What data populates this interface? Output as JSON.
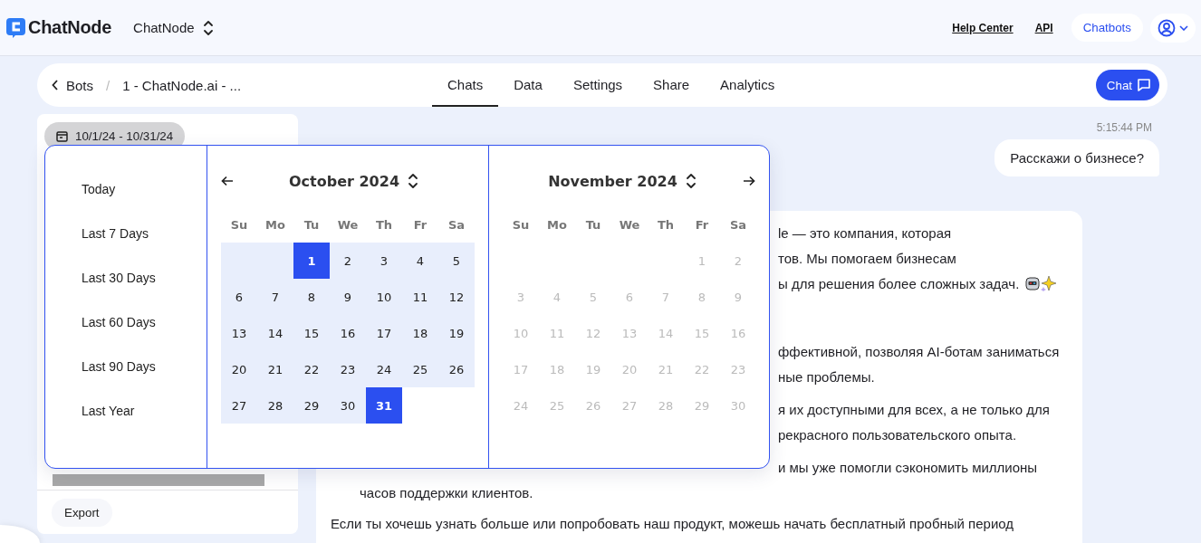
{
  "header": {
    "logo": "ChatNode",
    "workspace": "ChatNode",
    "links": [
      "Help Center",
      "API"
    ],
    "chatbots_button": "Chatbots"
  },
  "nav": {
    "back": "Bots",
    "separator": "/",
    "breadcrumb": "1 - ChatNode.ai - ...",
    "chat_button": "Chat",
    "tabs": [
      {
        "label": "Chats",
        "selected": true
      },
      {
        "label": "Data",
        "selected": false
      },
      {
        "label": "Settings",
        "selected": false
      },
      {
        "label": "Share",
        "selected": false
      },
      {
        "label": "Analytics",
        "selected": false
      }
    ]
  },
  "sidebar": {
    "date_range": "10/1/24 - 10/31/24",
    "export": "Export"
  },
  "date_picker": {
    "presets": [
      "Today",
      "Last 7 Days",
      "Last 30 Days",
      "Last 60 Days",
      "Last 90 Days",
      "Last Year"
    ],
    "months": [
      {
        "title": "October 2024",
        "weekdays": [
          "Su",
          "Mo",
          "Tu",
          "We",
          "Th",
          "Fr",
          "Sa"
        ],
        "weeks": [
          [
            {
              "kind": "blank",
              "in_range": true
            },
            {
              "kind": "blank",
              "in_range": true
            },
            {
              "label": "1",
              "selected": true,
              "in_range": true,
              "disabled": false
            },
            {
              "label": "2",
              "selected": false,
              "in_range": true,
              "disabled": false
            },
            {
              "label": "3",
              "selected": false,
              "in_range": true,
              "disabled": false
            },
            {
              "label": "4",
              "selected": false,
              "in_range": true,
              "disabled": false
            },
            {
              "label": "5",
              "selected": false,
              "in_range": true,
              "disabled": false
            }
          ],
          [
            {
              "label": "6",
              "selected": false,
              "in_range": true,
              "disabled": false
            },
            {
              "label": "7",
              "selected": false,
              "in_range": true,
              "disabled": false
            },
            {
              "label": "8",
              "selected": false,
              "in_range": true,
              "disabled": false
            },
            {
              "label": "9",
              "selected": false,
              "in_range": true,
              "disabled": false
            },
            {
              "label": "10",
              "selected": false,
              "in_range": true,
              "disabled": false
            },
            {
              "label": "11",
              "selected": false,
              "in_range": true,
              "disabled": false
            },
            {
              "label": "12",
              "selected": false,
              "in_range": true,
              "disabled": false
            }
          ],
          [
            {
              "label": "13",
              "selected": false,
              "in_range": true,
              "disabled": false
            },
            {
              "label": "14",
              "selected": false,
              "in_range": true,
              "disabled": false
            },
            {
              "label": "15",
              "selected": false,
              "in_range": true,
              "disabled": false
            },
            {
              "label": "16",
              "selected": false,
              "in_range": true,
              "disabled": false
            },
            {
              "label": "17",
              "selected": false,
              "in_range": true,
              "disabled": false
            },
            {
              "label": "18",
              "selected": false,
              "in_range": true,
              "disabled": false
            },
            {
              "label": "19",
              "selected": false,
              "in_range": true,
              "disabled": false
            }
          ],
          [
            {
              "label": "20",
              "selected": false,
              "in_range": true,
              "disabled": false
            },
            {
              "label": "21",
              "selected": false,
              "in_range": true,
              "disabled": false
            },
            {
              "label": "22",
              "selected": false,
              "in_range": true,
              "disabled": false
            },
            {
              "label": "23",
              "selected": false,
              "in_range": true,
              "disabled": false
            },
            {
              "label": "24",
              "selected": false,
              "in_range": true,
              "disabled": false
            },
            {
              "label": "25",
              "selected": false,
              "in_range": true,
              "disabled": false
            },
            {
              "label": "26",
              "selected": false,
              "in_range": true,
              "disabled": false
            }
          ],
          [
            {
              "label": "27",
              "selected": false,
              "in_range": true,
              "disabled": false
            },
            {
              "label": "28",
              "selected": false,
              "in_range": true,
              "disabled": false
            },
            {
              "label": "29",
              "selected": false,
              "in_range": true,
              "disabled": false
            },
            {
              "label": "30",
              "selected": false,
              "in_range": true,
              "disabled": false
            },
            {
              "label": "31",
              "selected": true,
              "in_range": true,
              "disabled": false
            }
          ]
        ]
      },
      {
        "title": "November 2024",
        "weekdays": [
          "Su",
          "Mo",
          "Tu",
          "We",
          "Th",
          "Fr",
          "Sa"
        ],
        "weeks": [
          [
            {
              "kind": "blank"
            },
            {
              "kind": "blank"
            },
            {
              "kind": "blank"
            },
            {
              "kind": "blank"
            },
            {
              "kind": "blank"
            },
            {
              "label": "1",
              "selected": false,
              "in_range": false,
              "disabled": true
            },
            {
              "label": "2",
              "selected": false,
              "in_range": false,
              "disabled": true
            }
          ],
          [
            {
              "label": "3",
              "selected": false,
              "in_range": false,
              "disabled": true
            },
            {
              "label": "4",
              "selected": false,
              "in_range": false,
              "disabled": true
            },
            {
              "label": "5",
              "selected": false,
              "in_range": false,
              "disabled": true
            },
            {
              "label": "6",
              "selected": false,
              "in_range": false,
              "disabled": true
            },
            {
              "label": "7",
              "selected": false,
              "in_range": false,
              "disabled": true
            },
            {
              "label": "8",
              "selected": false,
              "in_range": false,
              "disabled": true
            },
            {
              "label": "9",
              "selected": false,
              "in_range": false,
              "disabled": true
            }
          ],
          [
            {
              "label": "10",
              "selected": false,
              "in_range": false,
              "disabled": true
            },
            {
              "label": "11",
              "selected": false,
              "in_range": false,
              "disabled": true
            },
            {
              "label": "12",
              "selected": false,
              "in_range": false,
              "disabled": true
            },
            {
              "label": "13",
              "selected": false,
              "in_range": false,
              "disabled": true
            },
            {
              "label": "14",
              "selected": false,
              "in_range": false,
              "disabled": true
            },
            {
              "label": "15",
              "selected": false,
              "in_range": false,
              "disabled": true
            },
            {
              "label": "16",
              "selected": false,
              "in_range": false,
              "disabled": true
            }
          ],
          [
            {
              "label": "17",
              "selected": false,
              "in_range": false,
              "disabled": true
            },
            {
              "label": "18",
              "selected": false,
              "in_range": false,
              "disabled": true
            },
            {
              "label": "19",
              "selected": false,
              "in_range": false,
              "disabled": true
            },
            {
              "label": "20",
              "selected": false,
              "in_range": false,
              "disabled": true
            },
            {
              "label": "21",
              "selected": false,
              "in_range": false,
              "disabled": true
            },
            {
              "label": "22",
              "selected": false,
              "in_range": false,
              "disabled": true
            },
            {
              "label": "23",
              "selected": false,
              "in_range": false,
              "disabled": true
            }
          ],
          [
            {
              "label": "24",
              "selected": false,
              "in_range": false,
              "disabled": true
            },
            {
              "label": "25",
              "selected": false,
              "in_range": false,
              "disabled": true
            },
            {
              "label": "26",
              "selected": false,
              "in_range": false,
              "disabled": true
            },
            {
              "label": "27",
              "selected": false,
              "in_range": false,
              "disabled": true
            },
            {
              "label": "28",
              "selected": false,
              "in_range": false,
              "disabled": true
            },
            {
              "label": "29",
              "selected": false,
              "in_range": false,
              "disabled": true
            },
            {
              "label": "30",
              "selected": false,
              "in_range": false,
              "disabled": true
            }
          ]
        ]
      }
    ]
  },
  "chat": {
    "timestamp": "5:15:44 PM",
    "user_message": "Расскажи о бизнесе?",
    "reply": [
      [
        {
          "kind": "cut",
          "text": "le — это компания, которая"
        },
        {
          "kind": "cut",
          "text": "тов. Мы помогаем бизнесам"
        },
        {
          "kind": "cut",
          "text": "ы для решения более сложных задач."
        }
      ],
      [
        {
          "kind": "cut",
          "text": "ффективной, позволяя AI-ботам заниматься"
        },
        {
          "kind": "cut",
          "text": "ные проблемы."
        }
      ],
      [
        {
          "kind": "cut",
          "text": "я их доступными для всех, а не только для"
        },
        {
          "kind": "cut",
          "text": "рекрасного пользовательского опыта."
        }
      ],
      [
        {
          "kind": "cut",
          "text": "и мы уже помогли сэкономить миллионы"
        },
        {
          "kind": "item",
          "text": "часов поддержки клиентов."
        }
      ],
      [
        {
          "kind": "plain",
          "text": "Если ты хочешь узнать больше или попробовать наш продукт, можешь начать бесплатный пробный период"
        }
      ]
    ]
  }
}
